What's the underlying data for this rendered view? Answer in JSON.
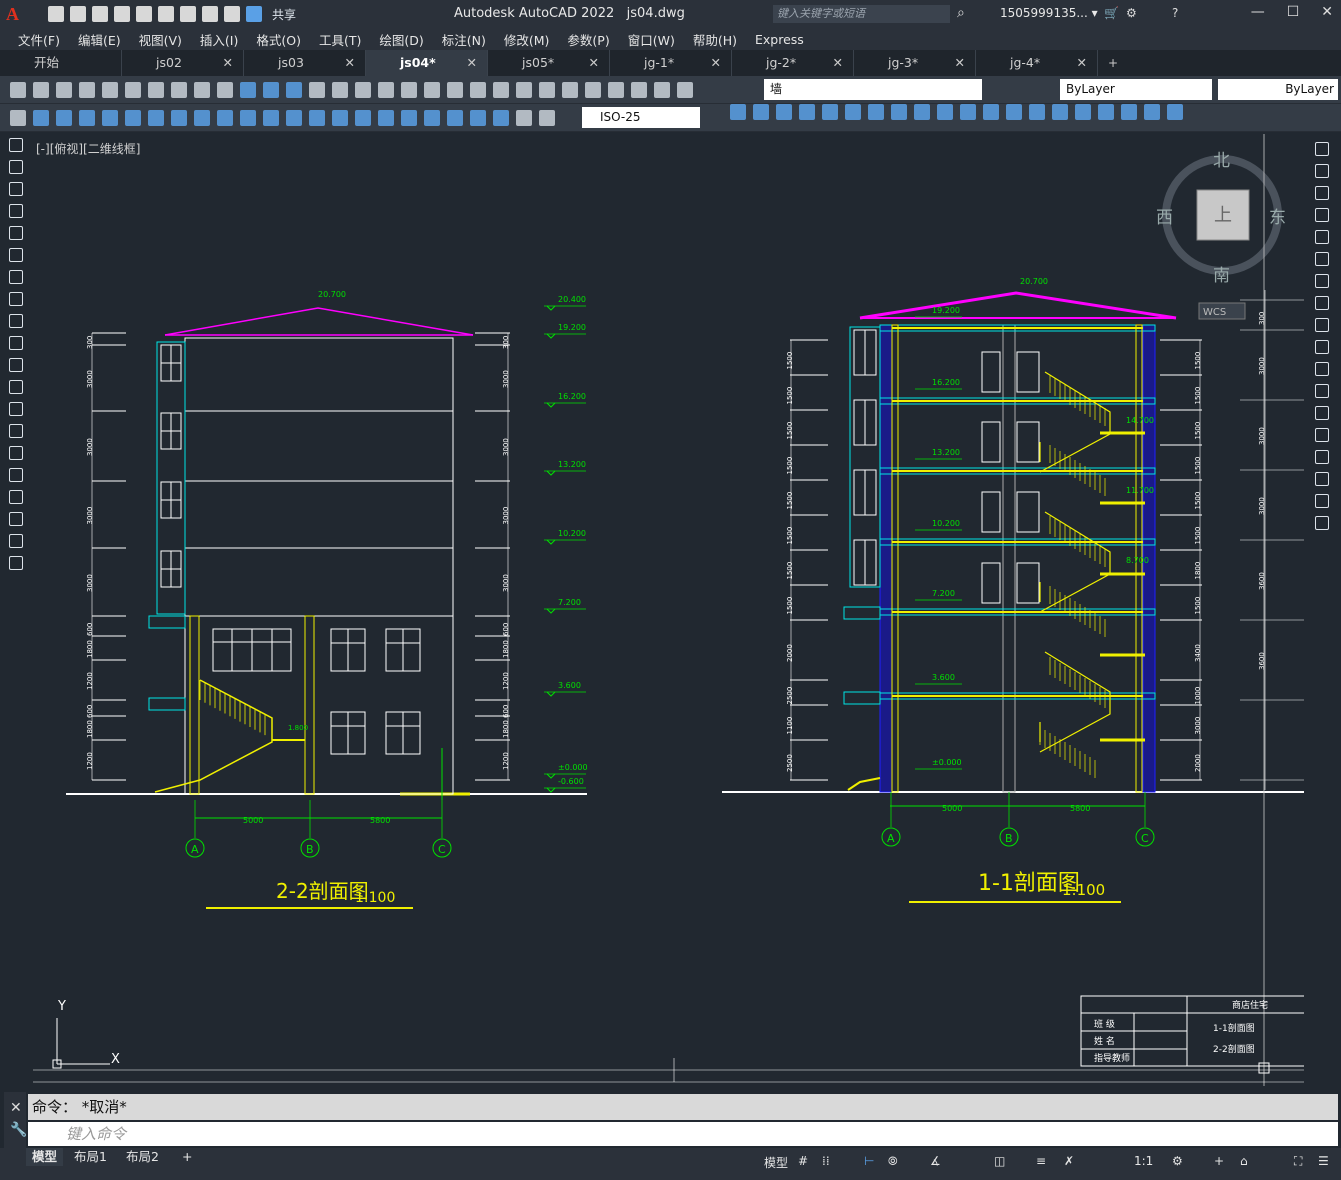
{
  "app": {
    "title": "Autodesk AutoCAD 2022",
    "file": "js04.dwg",
    "share_label": "共享",
    "search_placeholder": "键入关键字或短语",
    "user": "1505999135... ▾"
  },
  "menu": [
    "文件(F)",
    "编辑(E)",
    "视图(V)",
    "插入(I)",
    "格式(O)",
    "工具(T)",
    "绘图(D)",
    "标注(N)",
    "修改(M)",
    "参数(P)",
    "窗口(W)",
    "帮助(H)",
    "Express"
  ],
  "tabs": [
    {
      "label": "开始",
      "closable": false,
      "active": false
    },
    {
      "label": "js02",
      "closable": true,
      "active": false
    },
    {
      "label": "js03",
      "closable": true,
      "active": false
    },
    {
      "label": "js04*",
      "closable": true,
      "active": true
    },
    {
      "label": "js05*",
      "closable": true,
      "active": false
    },
    {
      "label": "jg-1*",
      "closable": true,
      "active": false
    },
    {
      "label": "jg-2*",
      "closable": true,
      "active": false
    },
    {
      "label": "jg-3*",
      "closable": true,
      "active": false
    },
    {
      "label": "jg-4*",
      "closable": true,
      "active": false
    }
  ],
  "toolbar": {
    "layer_name": "墙",
    "color": "ByLayer",
    "linetype": "ByLayer",
    "dimstyle": "ISO-25"
  },
  "viewport": {
    "label": "[-][俯视][二维线框]",
    "viewcube": {
      "north": "北",
      "south": "南",
      "east": "东",
      "west": "西",
      "top": "上",
      "wcs": "WCS"
    },
    "ucs_x": "X",
    "ucs_y": "Y"
  },
  "drawing": {
    "section22": {
      "title": "2-2剖面图",
      "scale": "1:100",
      "roof_elev": "20.700",
      "elev_labels": [
        "20.400",
        "19.200",
        "16.200",
        "13.200",
        "10.200",
        "7.200",
        "3.600",
        "±0.000",
        "-0.600"
      ],
      "left_dims": [
        "300",
        "3000",
        "3000",
        "3000",
        "3000",
        "600",
        "1800",
        "1200",
        "600",
        "1800",
        "1200"
      ],
      "right_dims": [
        "300",
        "3000",
        "3000",
        "3000",
        "3000",
        "600",
        "1800",
        "1200",
        "600",
        "1800",
        "1200"
      ],
      "bottom_dims": [
        "5000",
        "5800"
      ],
      "axes": [
        "A",
        "B",
        "C"
      ],
      "stair_elev": "1.800"
    },
    "section11": {
      "title": "1-1剖面图",
      "scale": "1:100",
      "roof_elev": "20.700",
      "elev_labels": [
        "19.200",
        "16.200",
        "13.200",
        "10.200",
        "7.200",
        "3.600",
        "±0.000"
      ],
      "stair_elevs": [
        "14.700",
        "11.700",
        "8.700"
      ],
      "left_dims": [
        "1500",
        "1500",
        "1500",
        "1500",
        "1500",
        "1500",
        "1500",
        "1500",
        "2000",
        "2500",
        "1100",
        "2500"
      ],
      "right_dims": [
        "1500",
        "1500",
        "1500",
        "1500",
        "1500",
        "1500",
        "1800",
        "1500",
        "3400",
        "1000",
        "3000",
        "2000"
      ],
      "far_right_dims": [
        "300",
        "3000",
        "3000",
        "3000",
        "3600",
        "3600"
      ],
      "bottom_dims": [
        "5000",
        "5800"
      ],
      "axes": [
        "A",
        "B",
        "C"
      ]
    },
    "title_block": {
      "project": "商店住宅",
      "rows": [
        {
          "label": "班 级",
          "value": "1-1剖面图"
        },
        {
          "label": "姓 名",
          "value": "2-2剖面图"
        },
        {
          "label": "指导教师",
          "value": ""
        }
      ]
    }
  },
  "command": {
    "history": "命令： *取消*",
    "placeholder": "键入命令"
  },
  "status": {
    "layouts": [
      {
        "label": "模型",
        "active": true
      },
      {
        "label": "布局1",
        "active": false
      },
      {
        "label": "布局2",
        "active": false
      }
    ],
    "model_label": "模型",
    "scale": "1:1"
  }
}
